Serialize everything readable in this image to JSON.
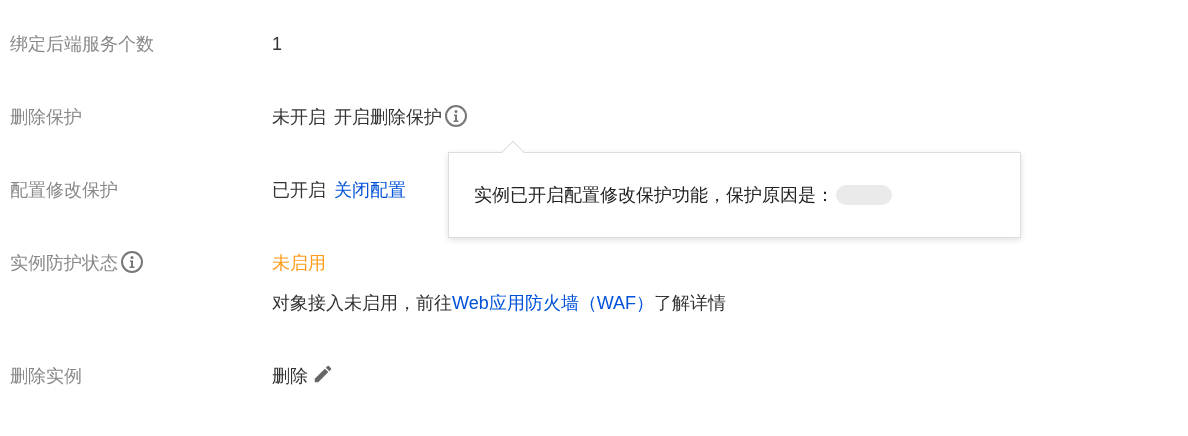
{
  "rows": [
    {
      "label": "绑定后端服务个数",
      "kind": "text",
      "value": "1"
    },
    {
      "label": "删除保护",
      "kind": "status_action",
      "status": "未开启",
      "action": "开启删除保护",
      "info_icon": true
    },
    {
      "label": "配置修改保护",
      "kind": "status_link",
      "status": "已开启",
      "link": "关闭配置"
    },
    {
      "label": "实例防护状态",
      "label_info_icon": true,
      "kind": "protection",
      "status": "未启用",
      "note": "对象接入未启用，前往",
      "link": "Web应用防火墙（WAF）",
      "note_end": "了解详情"
    },
    {
      "label": "删除实例",
      "kind": "edit",
      "value": "删除"
    }
  ],
  "tooltip": {
    "text": "实例已开启配置修改保护功能，保护原因是：",
    "redacted": true
  }
}
